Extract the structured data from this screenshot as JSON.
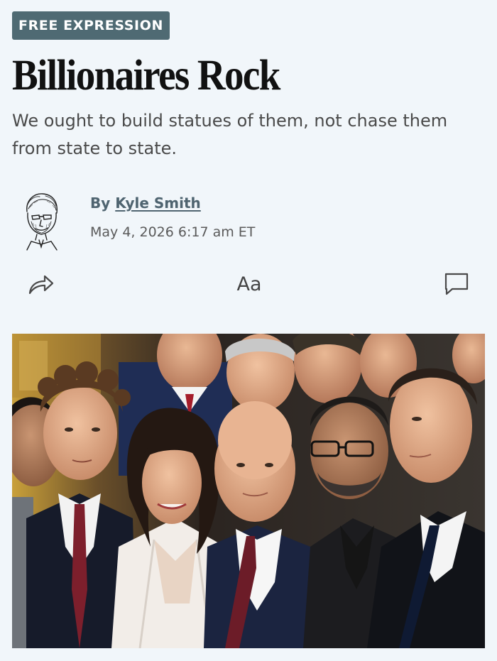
{
  "article": {
    "section_tag": "FREE EXPRESSION",
    "title": "Billionaires Rock",
    "subtitle": "We ought to build statues of them, not chase them from state to state.",
    "byline_prefix": "By",
    "author": "Kyle Smith",
    "timestamp": "May 4, 2026 6:17 am ET"
  },
  "toolbar": {
    "share_icon": "share-arrow-icon",
    "font_size_label": "Aa",
    "comment_icon": "comment-bubble-icon"
  },
  "colors": {
    "page_background": "#f1f6fa",
    "tag_background": "#4f6a73",
    "byline_color": "#4f6470"
  }
}
